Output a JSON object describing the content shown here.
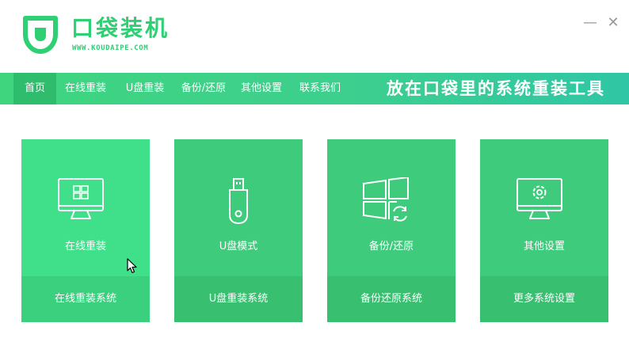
{
  "app": {
    "title": "口袋装机",
    "url": "WWW.KOUDAIPE.COM"
  },
  "window_controls": {
    "minimize": "—",
    "close": "✕"
  },
  "nav": {
    "items": [
      "首页",
      "在线重装",
      "U盘重装",
      "备份/还原",
      "其他设置",
      "联系我们"
    ],
    "active_index": 0,
    "slogan": "放在口袋里的系统重装工具"
  },
  "cards": [
    {
      "icon": "monitor-windows-icon",
      "title": "在线重装",
      "subtitle": "在线重装系统"
    },
    {
      "icon": "usb-drive-icon",
      "title": "U盘模式",
      "subtitle": "U盘重装系统"
    },
    {
      "icon": "windows-restore-icon",
      "title": "备份/还原",
      "subtitle": "备份还原系统"
    },
    {
      "icon": "monitor-gear-icon",
      "title": "其他设置",
      "subtitle": "更多系统设置"
    }
  ],
  "colors": {
    "brand": "#2fcf74",
    "nav_gradient_start": "#3fd57f",
    "nav_gradient_end": "#2fc6a5",
    "card": "#3ecb7c",
    "card_active": "#40e08a"
  }
}
